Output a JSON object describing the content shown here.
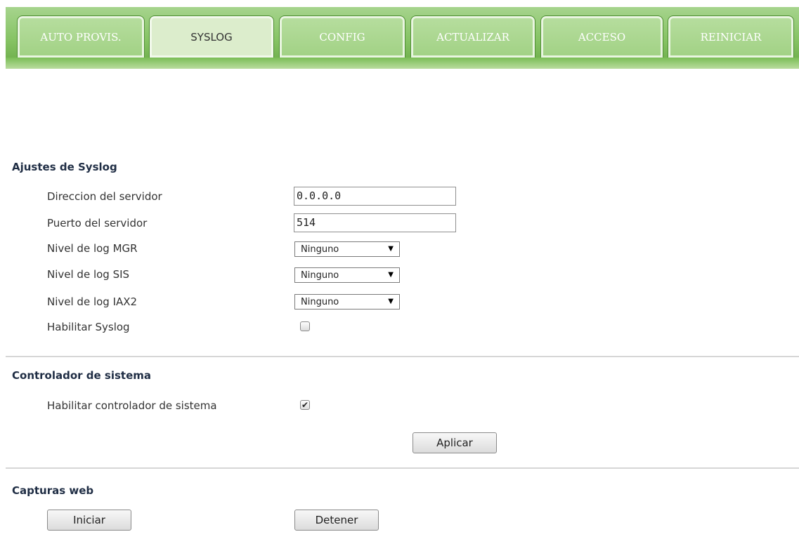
{
  "tabs": [
    {
      "label": "AUTO PROVIS."
    },
    {
      "label": "SYSLOG",
      "active": true
    },
    {
      "label": "CONFIG"
    },
    {
      "label": "ACTUALIZAR"
    },
    {
      "label": "ACCESO"
    },
    {
      "label": "REINICIAR"
    }
  ],
  "syslog_settings": {
    "title": "Ajustes de Syslog",
    "server_address": {
      "label": "Direccion del servidor",
      "value": "0.0.0.0"
    },
    "server_port": {
      "label": "Puerto del servidor",
      "value": "514"
    },
    "mgr_log_level": {
      "label": "Nivel de log MGR",
      "value": "Ninguno"
    },
    "sis_log_level": {
      "label": "Nivel de log SIS",
      "value": "Ninguno"
    },
    "iax2_log_level": {
      "label": "Nivel de log IAX2",
      "value": "Ninguno"
    },
    "enable_syslog": {
      "label": "Habilitar Syslog",
      "checked": false
    }
  },
  "system_controller": {
    "title": "Controlador de sistema",
    "enable": {
      "label": "Habilitar controlador de sistema",
      "checked": true
    },
    "apply_label": "Aplicar"
  },
  "web_captures": {
    "title": "Capturas web",
    "start_label": "Iniciar",
    "stop_label": "Detener"
  },
  "colors": {
    "tab_bar_green": "#86c364",
    "active_tab": "#dcedcc",
    "section_title": "#1f2d44"
  },
  "icons": {
    "dropdown": "triangle-down",
    "checkmark": "check-mark"
  }
}
